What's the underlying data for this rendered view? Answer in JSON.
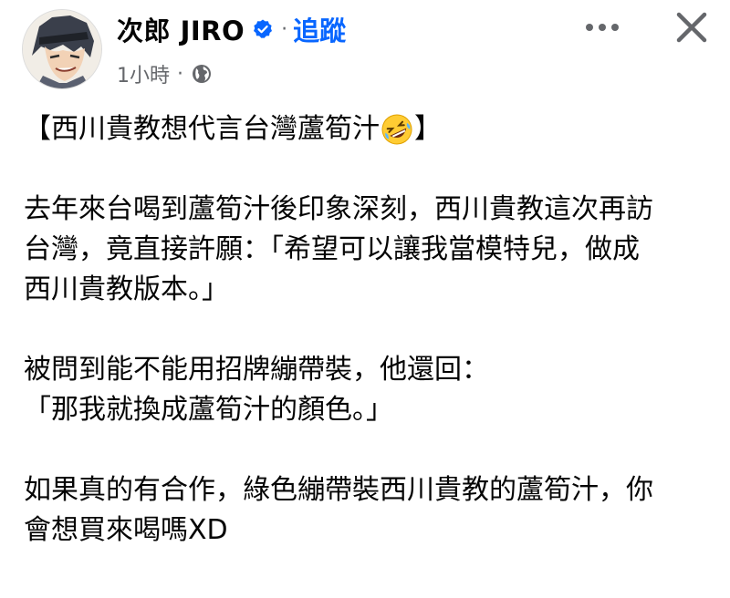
{
  "author": {
    "name": "次郎 JIRO",
    "separator": "·",
    "follow_label": "追蹤"
  },
  "meta": {
    "time": "1小時",
    "separator": "·",
    "audience_icon": "globe-icon"
  },
  "actions": {
    "more_icon": "more-icon",
    "close_icon": "close-icon"
  },
  "post": {
    "title_open": "【西川貴教想代言台灣蘆筍汁",
    "title_emoji": "rolling-on-floor-laughing-emoji",
    "title_close": "】",
    "paragraphs": [
      "去年來台喝到蘆筍汁後印象深刻，西川貴教這次再訪\n台灣，竟直接許願：「希望可以讓我當模特兒，做成\n西川貴教版本。」",
      "被問到能不能用招牌繃帶裝，他還回：\n「那我就換成蘆筍汁的顏色。」",
      "如果真的有合作，綠色繃帶裝西川貴教的蘆筍汁，你\n會想買來喝嗎XD"
    ]
  },
  "colors": {
    "link": "#0866ff",
    "verified": "#0866ff",
    "secondary_text": "#65676b",
    "primary_text": "#050505"
  }
}
